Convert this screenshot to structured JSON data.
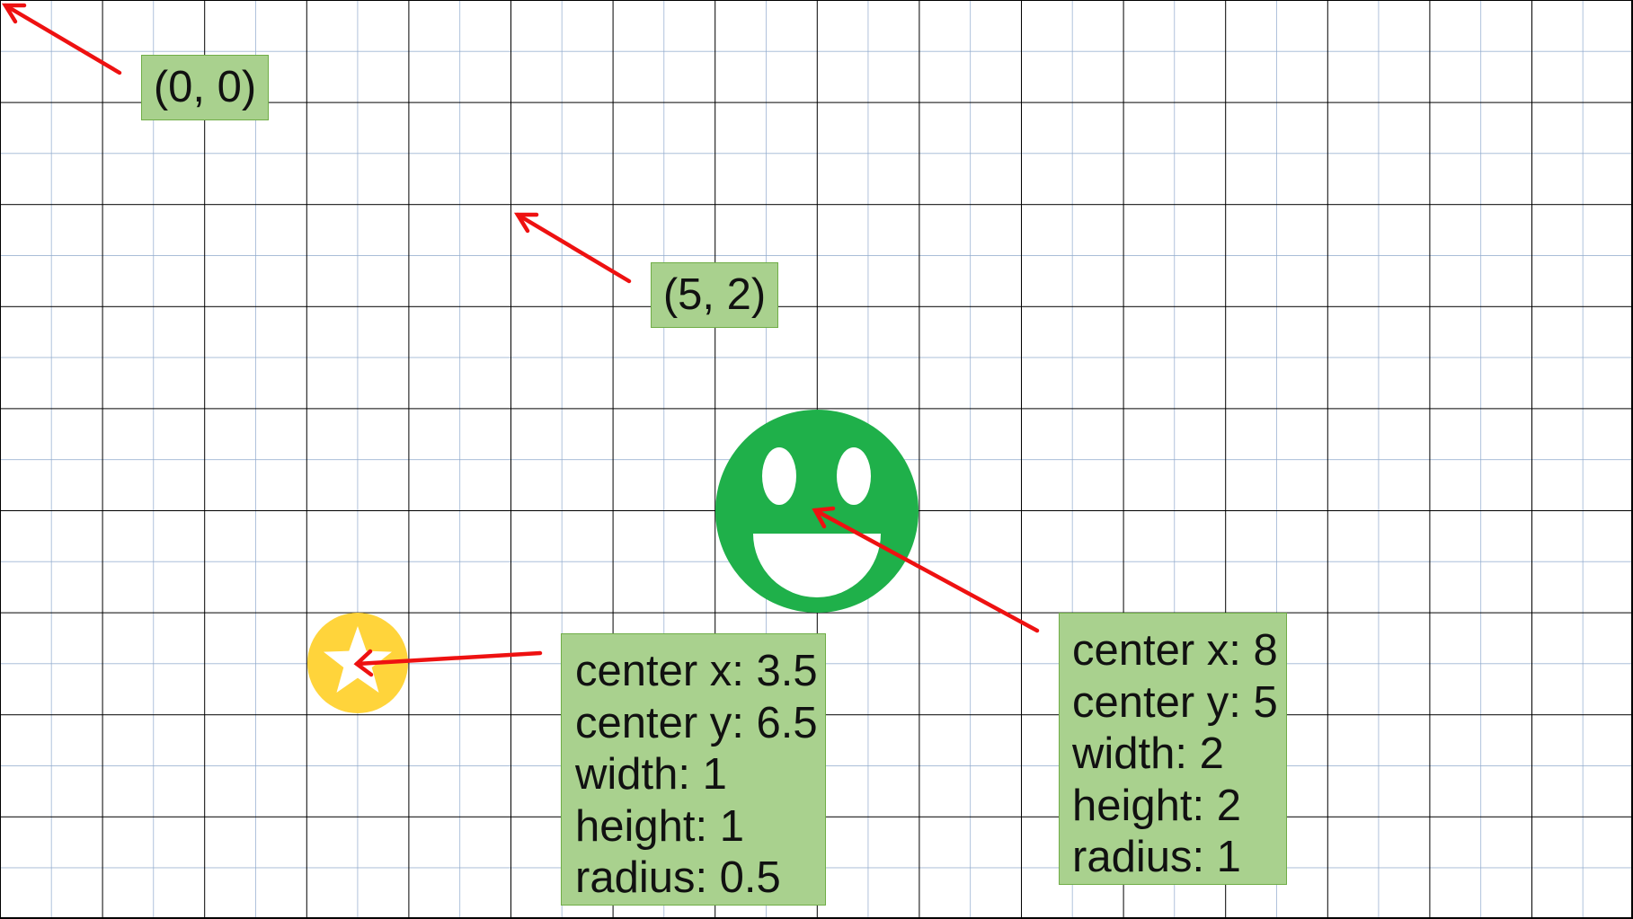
{
  "grid": {
    "major_line_color": "#000000",
    "minor_line_color": "#8ea9cc",
    "background": "#ffffff"
  },
  "labels": {
    "origin": "(0, 0)",
    "point": "(5, 2)",
    "star": {
      "center_x": "center x: 3.5",
      "center_y": "center y: 6.5",
      "width": "width: 1",
      "height": "height: 1",
      "radius": "radius: 0.5"
    },
    "smiley": {
      "center_x": "center x: 8",
      "center_y": "center y: 5",
      "width": "width: 2",
      "height": "height: 2",
      "radius": "radius: 1"
    }
  },
  "shapes": {
    "star_icon": {
      "center": [
        3.5,
        6.5
      ],
      "radius": 0.5,
      "color": "#ffd43b",
      "star_color": "#ffffff"
    },
    "smiley_icon": {
      "center": [
        8,
        5
      ],
      "radius": 1,
      "color": "#1fb04a",
      "feature_color": "#ffffff"
    }
  },
  "arrow_color": "#ee1111",
  "label_fill": "#a9d18e",
  "label_border": "#70ad47"
}
